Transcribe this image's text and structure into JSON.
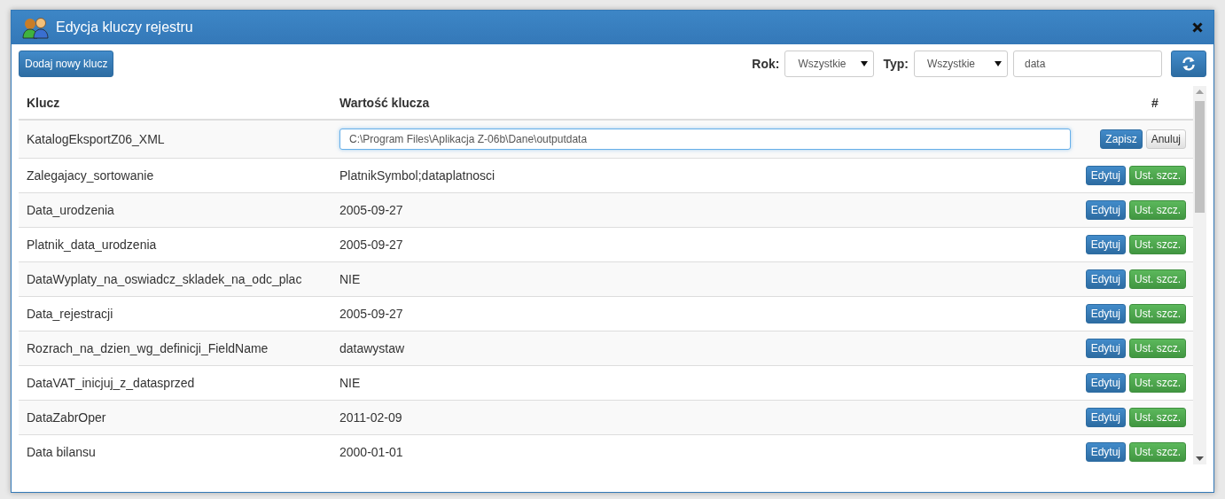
{
  "window": {
    "title": "Edycja kluczy rejestru"
  },
  "toolbar": {
    "add_button": "Dodaj nowy klucz",
    "year_label": "Rok:",
    "year_value": "Wszystkie",
    "type_label": "Typ:",
    "type_value": "Wszystkie",
    "search_value": "data"
  },
  "table": {
    "columns": [
      "Klucz",
      "Wartość klucza",
      "#"
    ],
    "rows": [
      {
        "key": "KatalogEksportZ06_XML",
        "value": "C:\\Program Files\\Aplikacja Z-06b\\Dane\\outputdata",
        "editing": true,
        "actions": [
          "Zapisz",
          "Anuluj"
        ]
      },
      {
        "key": "Zalegajacy_sortowanie",
        "value": "PlatnikSymbol;dataplatnosci",
        "editing": false,
        "actions": [
          "Edytuj",
          "Ust. szcz."
        ]
      },
      {
        "key": "Data_urodzenia",
        "value": "2005-09-27",
        "editing": false,
        "actions": [
          "Edytuj",
          "Ust. szcz."
        ]
      },
      {
        "key": "Platnik_data_urodzenia",
        "value": "2005-09-27",
        "editing": false,
        "actions": [
          "Edytuj",
          "Ust. szcz."
        ]
      },
      {
        "key": "DataWyplaty_na_oswiadcz_skladek_na_odc_plac",
        "value": "NIE",
        "editing": false,
        "actions": [
          "Edytuj",
          "Ust. szcz."
        ]
      },
      {
        "key": "Data_rejestracji",
        "value": "2005-09-27",
        "editing": false,
        "actions": [
          "Edytuj",
          "Ust. szcz."
        ]
      },
      {
        "key": "Rozrach_na_dzien_wg_definicji_FieldName",
        "value": "datawystaw",
        "editing": false,
        "actions": [
          "Edytuj",
          "Ust. szcz."
        ]
      },
      {
        "key": "DataVAT_inicjuj_z_datasprzed",
        "value": "NIE",
        "editing": false,
        "actions": [
          "Edytuj",
          "Ust. szcz."
        ]
      },
      {
        "key": "DataZabrOper",
        "value": "2011-02-09",
        "editing": false,
        "actions": [
          "Edytuj",
          "Ust. szcz."
        ]
      },
      {
        "key": "Data bilansu",
        "value": "2000-01-01",
        "editing": false,
        "actions": [
          "Edytuj",
          "Ust. szcz."
        ]
      }
    ]
  }
}
